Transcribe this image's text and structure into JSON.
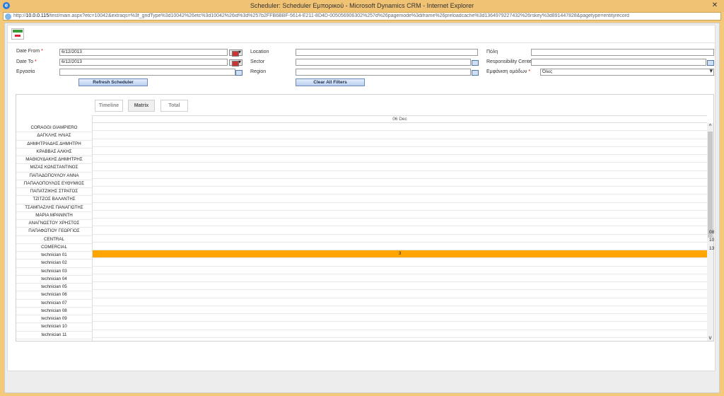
{
  "window": {
    "title": "Scheduler: Scheduler Εμπορικού - Microsoft Dynamics CRM - Internet Explorer",
    "url_prefix": "http://",
    "url_host": "10.0.0.115",
    "url_rest": "/test/main.aspx?etc=10042&extraqs=%3f_gridType%3d10042%26etc%3d10042%26id%3d%257b2FFB6BBF-5614-E211-8D4D-005056906302%257d%26pagemode%3diframe%26preloadcache%3d1364979227432%26rskey%3d891447828&pagetype=entityrecord",
    "close_glyph": "✕"
  },
  "filters": {
    "date_from": {
      "label": "Date From",
      "value": "6/12/2013"
    },
    "date_to": {
      "label": "Date To",
      "value": "6/12/2013"
    },
    "ergasia": {
      "label": "Εργασία",
      "value": ""
    },
    "location": {
      "label": "Location",
      "value": ""
    },
    "sector": {
      "label": "Sector",
      "value": ""
    },
    "region": {
      "label": "Region",
      "value": ""
    },
    "poli": {
      "label": "Πόλη",
      "value": ""
    },
    "responsibility_center": {
      "label": "Responsibility Center",
      "value": ""
    },
    "emfanisi_omadon": {
      "label": "Εμφάνιση ομάδων",
      "value": "Όλες"
    },
    "required_mark": "*",
    "refresh_button": "Refresh Scheduler",
    "clear_button": "Clear All Filters"
  },
  "tabs": [
    "Timeline",
    "Matrix",
    "Total"
  ],
  "scheduler": {
    "date_header": "06 Dec",
    "resources": [
      "CORAGGI GIAMPIERO",
      "ΔΑΓΚΛΗΣ ΗΛΙΑΣ",
      "ΔΗΜΗΤΡΙΑΔΗΣ ΔΗΜΗΤΡΗ",
      "ΚΡΑΒΒΑΣ ΑΛΚΗΣ",
      "ΜΑΘΙΟΥΔΑΚΗΣ ΔΗΜΗΤΡΗΣ",
      "ΜΙΖΑΣ ΚΩΝΣΤΑΝΤΙΝΟΣ",
      "ΠΑΠΑΔΟΠΟΥΛΟΥ ΑΝΝΑ",
      "ΠΑΠΑΛΟΠΟΥΛΟΣ ΕΥΘΥΜΙΟΣ",
      "ΠΑΠΑΤΖΙΚΗΣ ΣΤΡΑΤΟΣ",
      "ΤΖΙΤΖΟΣ ΒΑΛΑΝΤΗΣ",
      "ΤΣΑΜΠΑΖΛΗΣ ΠΑΝΑΓΙΩΤΗΣ",
      "ΜΑΡΙΑ ΜΡΑΝΙΝΤΗ",
      "ΑΝΑΓΝΩΣΤΟΥ ΧΡΗΣΤΟΣ",
      "ΠΑΠΑΦΩΤΙΟΥ ΓΕΩΡΓΙΟΣ",
      "CENTRAL",
      "COMERCIAL",
      "technician 01",
      "technician 02",
      "technician 03",
      "technician 04",
      "technician 05",
      "technician 06",
      "technician 07",
      "technician 08",
      "technician 09",
      "technician 10",
      "technician 11"
    ],
    "highlight_row_value": "3",
    "highlight_color": "#ffa500",
    "overflow_values": [
      "08",
      "10",
      "13"
    ],
    "scroll_up_glyph": "^",
    "scroll_down_glyph": "v"
  }
}
